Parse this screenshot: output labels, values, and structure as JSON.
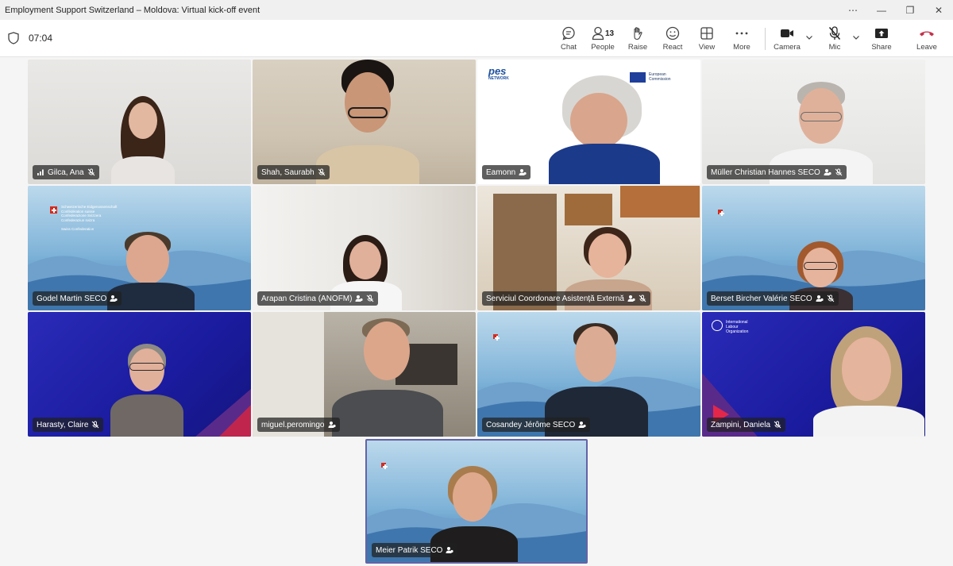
{
  "window": {
    "title": "Employment Support Switzerland – Moldova: Virtual kick-off event",
    "more_glyph": "⋯",
    "minimize_glyph": "—",
    "restore_glyph": "❐",
    "close_glyph": "✕"
  },
  "toolbar": {
    "timer": "07:04",
    "chat_label": "Chat",
    "people_label": "People",
    "people_count": "13",
    "raise_label": "Raise",
    "react_label": "React",
    "view_label": "View",
    "more_label": "More",
    "camera_label": "Camera",
    "mic_label": "Mic",
    "share_label": "Share",
    "leave_label": "Leave"
  },
  "participants": [
    {
      "name": "Gilca, Ana",
      "status_icon": "signal-bars-icon",
      "muted": true
    },
    {
      "name": "Shah, Saurabh",
      "muted": true
    },
    {
      "name": "Eamonn",
      "status_icon": "participant-icon"
    },
    {
      "name": "Müller Christian Hannes SECO",
      "status_icon": "participant-icon",
      "muted": true
    },
    {
      "name": "Godel Martin SECO",
      "status_icon": "participant-icon"
    },
    {
      "name": "Arapan Cristina (ANOFM)",
      "status_icon": "participant-icon",
      "muted": true
    },
    {
      "name": "Serviciul Coordonare Asistență Externă",
      "status_icon": "participant-icon",
      "muted": true
    },
    {
      "name": "Berset Bircher Valérie SECO",
      "status_icon": "participant-icon",
      "muted": true
    },
    {
      "name": "Harasty, Claire",
      "muted": true
    },
    {
      "name": "miguel.peromingo",
      "status_icon": "participant-icon"
    },
    {
      "name": "Cosandey Jérôme SECO",
      "status_icon": "participant-icon"
    },
    {
      "name": "Zampini, Daniela",
      "muted": true
    },
    {
      "name": "Meier Patrik SECO",
      "status_icon": "participant-icon",
      "active_speaker": true
    }
  ],
  "backgrounds": {
    "pes_logo": "pes",
    "pes_network": "NETWORK",
    "ec_line1": "European",
    "ec_line2": "Commission",
    "swiss_line1": "Schweizerische Eidgenossenschaft",
    "swiss_line2": "Confédération suisse",
    "swiss_line3": "Confederazione Svizzera",
    "swiss_line4": "Confederaziun svizra",
    "swiss_line5": "Swiss Confederation",
    "ilo_line1": "International",
    "ilo_line2": "Labour",
    "ilo_line3": "Organization"
  },
  "colors": {
    "accent": "#6264a7",
    "leave": "#c4314b",
    "toolbar_bg": "#ffffff",
    "stage_bg": "#f5f5f5"
  }
}
